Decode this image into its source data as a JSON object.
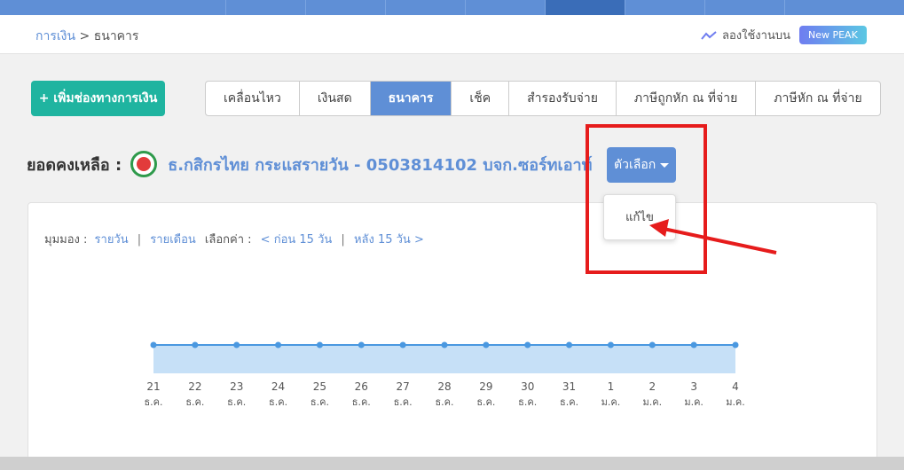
{
  "breadcrumb": {
    "parent": "การเงิน",
    "separator": " > ",
    "current": "ธนาคาร"
  },
  "try_banner": {
    "icon": "trend-line-icon",
    "text": "ลองใช้งานบน",
    "badge": "New PEAK"
  },
  "add_button": "+ เพิ่มช่องทางการเงิน",
  "tabs": [
    "เคลื่อนไหว",
    "เงินสด",
    "ธนาคาร",
    "เช็ค",
    "สำรองรับจ่าย",
    "ภาษีถูกหัก ณ ที่จ่าย",
    "ภาษีหัก ณ ที่จ่าย"
  ],
  "active_tab": "ธนาคาร",
  "balance": {
    "label": "ยอดคงเหลือ :",
    "account": "ธ.กสิกรไทย กระแสรายวัน - 0503814102 บจก.ซอร์ทเอาท์"
  },
  "options_button": "ตัวเลือก",
  "dropdown": {
    "items": [
      "แก้ไข"
    ]
  },
  "view": {
    "label": "มุมมอง :",
    "daily": "รายวัน",
    "sep": "|",
    "monthly": "รายเดือน",
    "select_label": "เลือกค่า :",
    "prev": "< ก่อน 15 วัน",
    "next": "หลัง 15 วัน >"
  },
  "colors": {
    "accent": "#5f8fd6",
    "teal": "#1fb4a0",
    "highlight": "#e61c1c",
    "area_fill": "#c6e0f7"
  },
  "chart_data": {
    "type": "area",
    "x": [
      "21",
      "22",
      "23",
      "24",
      "25",
      "26",
      "27",
      "28",
      "29",
      "30",
      "31",
      "1",
      "2",
      "3",
      "4"
    ],
    "x_sub": [
      "ธ.ค.",
      "ธ.ค.",
      "ธ.ค.",
      "ธ.ค.",
      "ธ.ค.",
      "ธ.ค.",
      "ธ.ค.",
      "ธ.ค.",
      "ธ.ค.",
      "ธ.ค.",
      "ธ.ค.",
      "ม.ค.",
      "ม.ค.",
      "ม.ค.",
      "ม.ค."
    ],
    "values": [
      0,
      0,
      0,
      0,
      0,
      0,
      0,
      0,
      0,
      0,
      0,
      0,
      0,
      0,
      0
    ],
    "grid": false
  }
}
